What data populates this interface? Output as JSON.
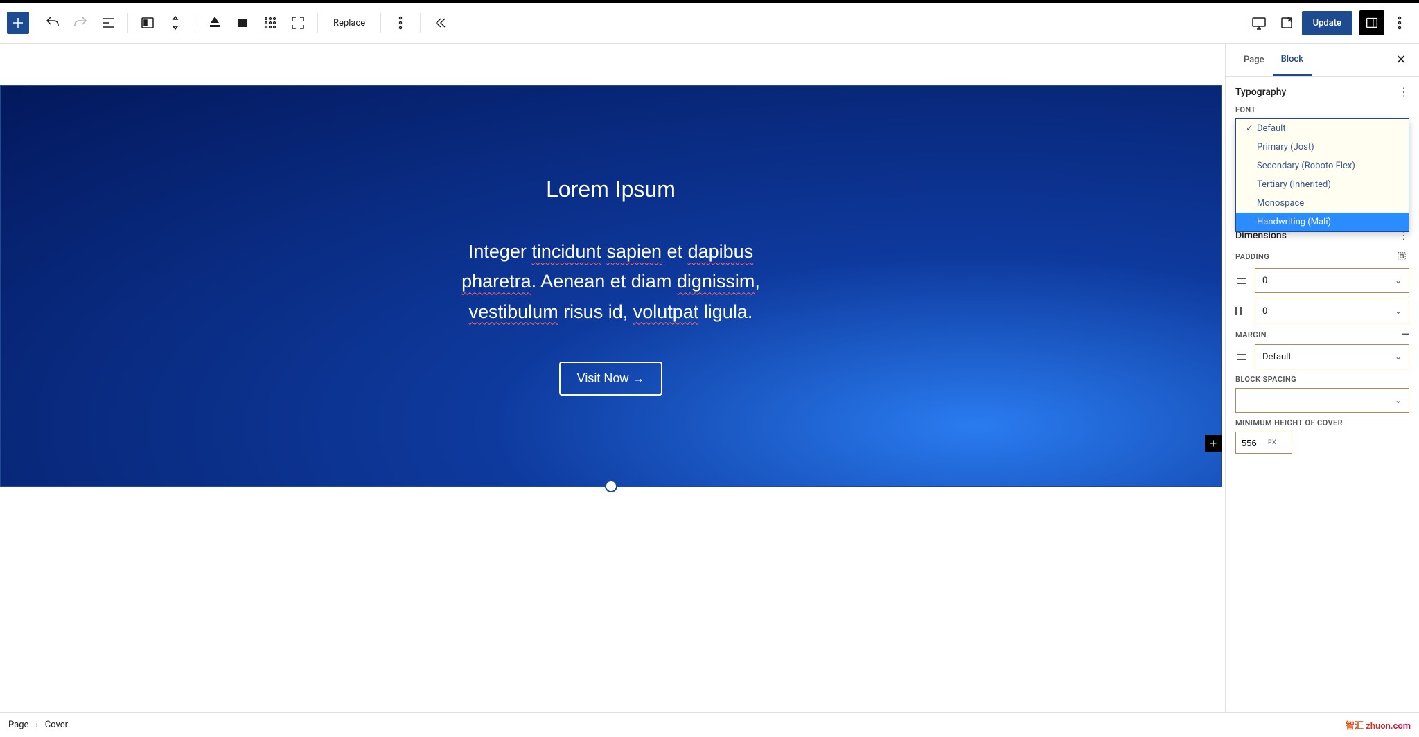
{
  "toolbar": {
    "replace_label": "Replace",
    "update_label": "Update"
  },
  "cover": {
    "title": "Lorem Ipsum",
    "para_parts": {
      "p1": "Integer ",
      "u1": "tincidunt",
      "p2": " ",
      "u2": "sapien",
      "p3": " et ",
      "u3": "dapibus",
      "p4": " ",
      "u4": "pharetra",
      "p5": ". Aenean et diam ",
      "u5": "dignissim",
      "p6": ", ",
      "u6": "vestibulum",
      "p7": " risus id, ",
      "u7": "volutpat",
      "p8": " ligula."
    },
    "button_label": "Visit Now →"
  },
  "sidebar": {
    "tabs": {
      "page": "Page",
      "block": "Block"
    },
    "typography_title": "Typography",
    "font_label": "FONT",
    "font_options": [
      {
        "label": "Default",
        "checked": true,
        "highlighted": false
      },
      {
        "label": "Primary (Jost)",
        "checked": false,
        "highlighted": false
      },
      {
        "label": "Secondary (Roboto Flex)",
        "checked": false,
        "highlighted": false
      },
      {
        "label": "Tertiary (Inherited)",
        "checked": false,
        "highlighted": false
      },
      {
        "label": "Monospace",
        "checked": false,
        "highlighted": false
      },
      {
        "label": "Handwriting (Mali)",
        "checked": false,
        "highlighted": true
      }
    ],
    "dimensions_title": "Dimensions",
    "padding_label": "PADDING",
    "padding_v": "0",
    "padding_h": "0",
    "margin_label": "MARGIN",
    "margin_value": "Default",
    "block_spacing_label": "BLOCK SPACING",
    "block_spacing_value": "",
    "min_height_label": "MINIMUM HEIGHT OF COVER",
    "min_height_value": "556",
    "min_height_unit": "PX"
  },
  "breadcrumb": {
    "page": "Page",
    "cover": "Cover"
  },
  "watermark": "智汇 zhuon.com"
}
